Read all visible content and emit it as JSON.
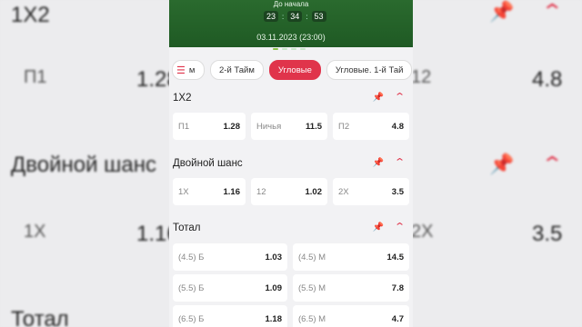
{
  "hero": {
    "label": "До начала",
    "timer": [
      "23",
      "34",
      "53"
    ],
    "date": "03.11.2023 (23:00)"
  },
  "tabs": [
    {
      "label": "м"
    },
    {
      "label": "2-й Тайм"
    },
    {
      "label": "Угловые"
    },
    {
      "label": "Угловые. 1-й Тай"
    }
  ],
  "markets": {
    "m1x2": {
      "title": "1X2",
      "odds": [
        {
          "name": "П1",
          "value": "1.28"
        },
        {
          "name": "Ничья",
          "value": "11.5"
        },
        {
          "name": "П2",
          "value": "4.8"
        }
      ]
    },
    "double": {
      "title": "Двойной шанс",
      "odds": [
        {
          "name": "1X",
          "value": "1.16"
        },
        {
          "name": "12",
          "value": "1.02"
        },
        {
          "name": "2X",
          "value": "3.5"
        }
      ]
    },
    "total": {
      "title": "Тотал",
      "odds": [
        {
          "name": "(4.5) Б",
          "value": "1.03"
        },
        {
          "name": "(4.5) М",
          "value": "14.5"
        },
        {
          "name": "(5.5) Б",
          "value": "1.09"
        },
        {
          "name": "(5.5) М",
          "value": "7.8"
        },
        {
          "name": "(6.5) Б",
          "value": "1.18"
        },
        {
          "name": "(6.5) М",
          "value": "4.7"
        }
      ]
    }
  },
  "background": {
    "b1": "1X2",
    "b2": "П1",
    "b3": "1.28",
    "b4": "12",
    "b5": "4.8",
    "b6": "Двойной шанс",
    "b7": "1X",
    "b8": "1.16",
    "b9": "2X",
    "b10": "3.5",
    "b11": "Тотал"
  }
}
